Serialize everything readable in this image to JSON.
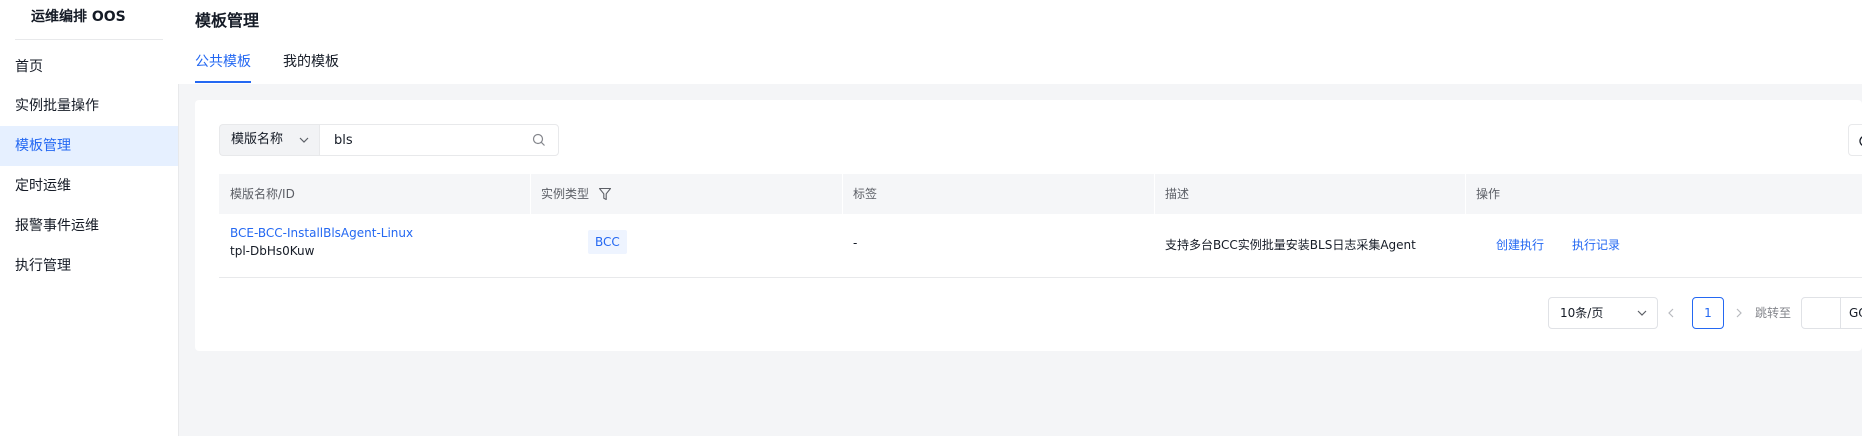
{
  "sidebar": {
    "title": "运维编排 OOS",
    "items": [
      {
        "label": "首页"
      },
      {
        "label": "实例批量操作"
      },
      {
        "label": "模板管理"
      },
      {
        "label": "定时运维"
      },
      {
        "label": "报警事件运维"
      },
      {
        "label": "执行管理"
      }
    ],
    "active_index": 2
  },
  "header": {
    "page_title": "模板管理",
    "tabs": [
      {
        "label": "公共模板"
      },
      {
        "label": "我的模板"
      }
    ],
    "active_tab": 0
  },
  "search": {
    "field_label": "模版名称",
    "value": "bls"
  },
  "table": {
    "columns": [
      {
        "label": "模版名称/ID"
      },
      {
        "label": "实例类型"
      },
      {
        "label": "标签"
      },
      {
        "label": "描述"
      },
      {
        "label": "操作"
      }
    ],
    "rows": [
      {
        "name": "BCE-BCC-InstallBlsAgent-Linux",
        "id": "tpl-DbHs0Kuw",
        "instance_type": "BCC",
        "tags": "-",
        "description": "支持多台BCC实例批量安装BLS日志采集Agent",
        "actions": [
          "创建执行",
          "执行记录"
        ]
      }
    ]
  },
  "pagination": {
    "page_size": "10条/页",
    "current_page": "1",
    "jump_label": "跳转至",
    "go_label": "GO"
  },
  "colors": {
    "accent": "#2468f2",
    "sidebar_active_bg": "#e6f0ff",
    "page_bg": "#f4f5f7"
  },
  "icons": {
    "search": "search-icon",
    "filter": "filter-icon",
    "dropdown": "chevron-down-icon",
    "refresh": "refresh-icon",
    "prev": "chevron-left-icon",
    "next": "chevron-right-icon"
  }
}
